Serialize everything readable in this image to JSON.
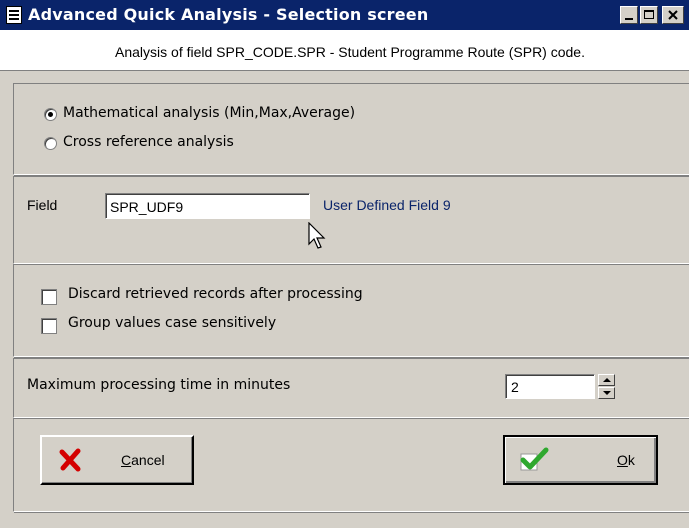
{
  "window": {
    "title": "Advanced Quick Analysis - Selection screen",
    "subtitle": "Analysis of field SPR_CODE.SPR - Student Programme Route (SPR) code."
  },
  "analysis_type": {
    "options": [
      {
        "label": "Mathematical analysis (Min,Max,Average)",
        "selected": true
      },
      {
        "label": "Cross reference analysis",
        "selected": false
      }
    ]
  },
  "field": {
    "label": "Field",
    "value": "SPR_UDF9",
    "description": "User Defined Field 9"
  },
  "options": {
    "discard": {
      "label": "Discard retrieved records after processing",
      "checked": false
    },
    "group_case": {
      "label": "Group values case sensitively",
      "checked": false
    }
  },
  "max_time": {
    "label": "Maximum processing time in minutes",
    "value": "2"
  },
  "buttons": {
    "cancel": {
      "label_underlined": "C",
      "label_rest": "ancel"
    },
    "ok": {
      "label_underlined": "O",
      "label_rest": "k"
    }
  },
  "colors": {
    "titlebar": "#0a246a",
    "face": "#d4d0c8",
    "link_text": "#0a246a"
  }
}
